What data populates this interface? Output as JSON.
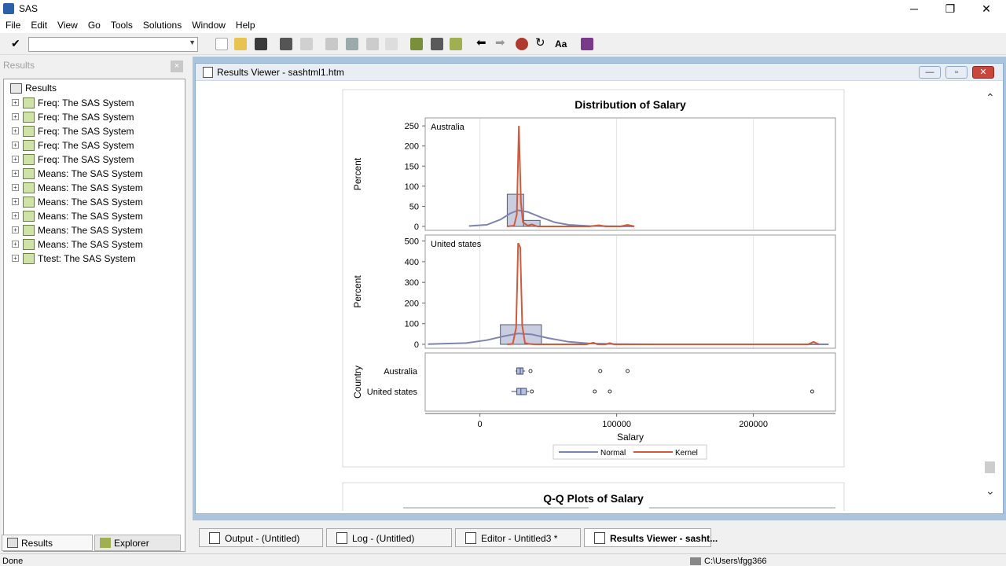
{
  "app": {
    "title": "SAS"
  },
  "window_controls": {
    "minimize": "─",
    "restore": "❐",
    "close": "✕"
  },
  "menu": [
    "File",
    "Edit",
    "View",
    "Go",
    "Tools",
    "Solutions",
    "Window",
    "Help"
  ],
  "toolbar": {
    "command_value": "",
    "icons": [
      "new-icon",
      "open-icon",
      "save-icon",
      "print-icon",
      "print-preview-icon",
      "cut-icon",
      "copy-icon",
      "paste-icon",
      "undo-icon",
      "new-library-icon",
      "sas-explorer-icon",
      "query-icon",
      "back-icon",
      "forward-icon",
      "stop-icon",
      "refresh-icon",
      "font-icon",
      "help-book-icon"
    ]
  },
  "results_panel": {
    "header": "Results",
    "close_label": "×",
    "root": "Results",
    "items": [
      "Freq:  The SAS System",
      "Freq:  The SAS System",
      "Freq:  The SAS System",
      "Freq:  The SAS System",
      "Freq:  The SAS System",
      "Means:  The SAS System",
      "Means:  The SAS System",
      "Means:  The SAS System",
      "Means:  The SAS System",
      "Means:  The SAS System",
      "Means:  The SAS System",
      "Ttest:  The SAS System"
    ],
    "tabs": [
      "Results",
      "Explorer"
    ]
  },
  "results_viewer": {
    "title": "Results Viewer - sashtml1.htm",
    "buttons": {
      "minimize": "—",
      "maximize": "▫",
      "close": "✕"
    }
  },
  "chart_data": {
    "type": "histogram-panel",
    "title": "Distribution of Salary",
    "second_title": "Q-Q Plots of Salary",
    "xlabel": "Salary",
    "x_ticks": [
      0,
      100000,
      200000
    ],
    "x_tick_labels": [
      "0",
      "100000",
      "200000"
    ],
    "xlim": [
      -40000,
      260000
    ],
    "panels": [
      {
        "label": "Australia",
        "ylabel": "Percent",
        "y_ticks": [
          0,
          50,
          100,
          150,
          200,
          250
        ],
        "ylim": [
          0,
          260
        ],
        "bars": [
          {
            "x0": 20000,
            "x1": 32000,
            "pct": 80
          },
          {
            "x0": 32000,
            "x1": 44000,
            "pct": 15
          }
        ],
        "normal_curve": [
          [
            -8000,
            1
          ],
          [
            5000,
            4
          ],
          [
            15000,
            17
          ],
          [
            22000,
            32
          ],
          [
            28000,
            40
          ],
          [
            35000,
            36
          ],
          [
            45000,
            22
          ],
          [
            55000,
            10
          ],
          [
            65000,
            4
          ],
          [
            80000,
            1
          ],
          [
            112000,
            0
          ]
        ],
        "kernel_curve": [
          [
            20000,
            0
          ],
          [
            25000,
            2
          ],
          [
            27000,
            30
          ],
          [
            28500,
            250
          ],
          [
            30000,
            60
          ],
          [
            31500,
            10
          ],
          [
            35000,
            2
          ],
          [
            38000,
            5
          ],
          [
            42000,
            0
          ],
          [
            80000,
            0
          ],
          [
            87000,
            3
          ],
          [
            92000,
            0
          ],
          [
            103000,
            0
          ],
          [
            108000,
            4
          ],
          [
            113000,
            0
          ]
        ]
      },
      {
        "label": "United states",
        "ylabel": "Percent",
        "y_ticks": [
          0,
          100,
          200,
          300,
          400,
          500
        ],
        "ylim": [
          0,
          510
        ],
        "bars": [
          {
            "x0": 15000,
            "x1": 45000,
            "pct": 95
          }
        ],
        "normal_curve": [
          [
            -38000,
            1
          ],
          [
            -10000,
            6
          ],
          [
            5000,
            20
          ],
          [
            18000,
            40
          ],
          [
            28000,
            52
          ],
          [
            38000,
            48
          ],
          [
            50000,
            30
          ],
          [
            65000,
            12
          ],
          [
            80000,
            4
          ],
          [
            100000,
            1
          ],
          [
            130000,
            0
          ],
          [
            255000,
            0
          ]
        ],
        "kernel_curve": [
          [
            20000,
            0
          ],
          [
            24000,
            2
          ],
          [
            26500,
            80
          ],
          [
            28000,
            490
          ],
          [
            29500,
            470
          ],
          [
            31000,
            90
          ],
          [
            33000,
            6
          ],
          [
            36000,
            2
          ],
          [
            40000,
            0
          ],
          [
            78000,
            0
          ],
          [
            83000,
            8
          ],
          [
            86000,
            0
          ],
          [
            92000,
            0
          ],
          [
            95000,
            6
          ],
          [
            98000,
            0
          ],
          [
            240000,
            0
          ],
          [
            244000,
            12
          ],
          [
            248000,
            0
          ]
        ]
      }
    ],
    "box_plot": {
      "ylabel": "Country",
      "categories": [
        "Australia",
        "United states"
      ],
      "series": [
        {
          "name": "Australia",
          "q1": 27000,
          "median": 29500,
          "q3": 31500,
          "whisker_low": 26000,
          "whisker_high": 33000,
          "outliers": [
            37000,
            88000,
            108000
          ]
        },
        {
          "name": "United states",
          "q1": 27000,
          "median": 30000,
          "q3": 34000,
          "whisker_low": 23000,
          "whisker_high": 36000,
          "outliers": [
            38000,
            84000,
            95000,
            243000
          ]
        }
      ]
    },
    "legend": {
      "placement": "bottom",
      "items": [
        {
          "name": "Normal",
          "color": "#7e84b0"
        },
        {
          "name": "Kernel",
          "color": "#d2593a"
        }
      ]
    },
    "colors": {
      "bar_fill": "#c8cde0",
      "bar_stroke": "#555a70",
      "grid": "#e3e3e3"
    }
  },
  "window_tabs": [
    {
      "label": "Output - (Untitled)",
      "active": false
    },
    {
      "label": "Log - (Untitled)",
      "active": false
    },
    {
      "label": "Editor - Untitled3 *",
      "active": false
    },
    {
      "label": "Results Viewer - sasht...",
      "active": true
    }
  ],
  "status": {
    "left": "Done",
    "right": "C:\\Users\\fgg366"
  }
}
